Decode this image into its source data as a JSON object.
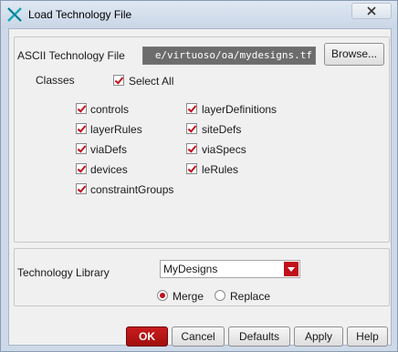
{
  "window": {
    "title": "Load Technology File"
  },
  "ascii_file": {
    "label": "ASCII Technology File",
    "value": "e/virtuoso/oa/mydesigns.tf",
    "browse_label": "Browse..."
  },
  "classes": {
    "label": "Classes",
    "select_all": {
      "label": "Select All",
      "checked": true
    },
    "items": [
      {
        "label": "controls",
        "checked": true
      },
      {
        "label": "layerDefinitions",
        "checked": true
      },
      {
        "label": "layerRules",
        "checked": true
      },
      {
        "label": "siteDefs",
        "checked": true
      },
      {
        "label": "viaDefs",
        "checked": true
      },
      {
        "label": "viaSpecs",
        "checked": true
      },
      {
        "label": "devices",
        "checked": true
      },
      {
        "label": "leRules",
        "checked": true
      },
      {
        "label": "constraintGroups",
        "checked": true
      }
    ]
  },
  "tech_library": {
    "label": "Technology Library",
    "selected": "MyDesigns",
    "mode_merge": "Merge",
    "mode_replace": "Replace",
    "selected_mode": "Merge"
  },
  "buttons": {
    "ok": "OK",
    "cancel": "Cancel",
    "defaults": "Defaults",
    "apply": "Apply",
    "help": "Help"
  },
  "colors": {
    "accent": "#c0101a",
    "titlebar": "#cdd9e8"
  }
}
